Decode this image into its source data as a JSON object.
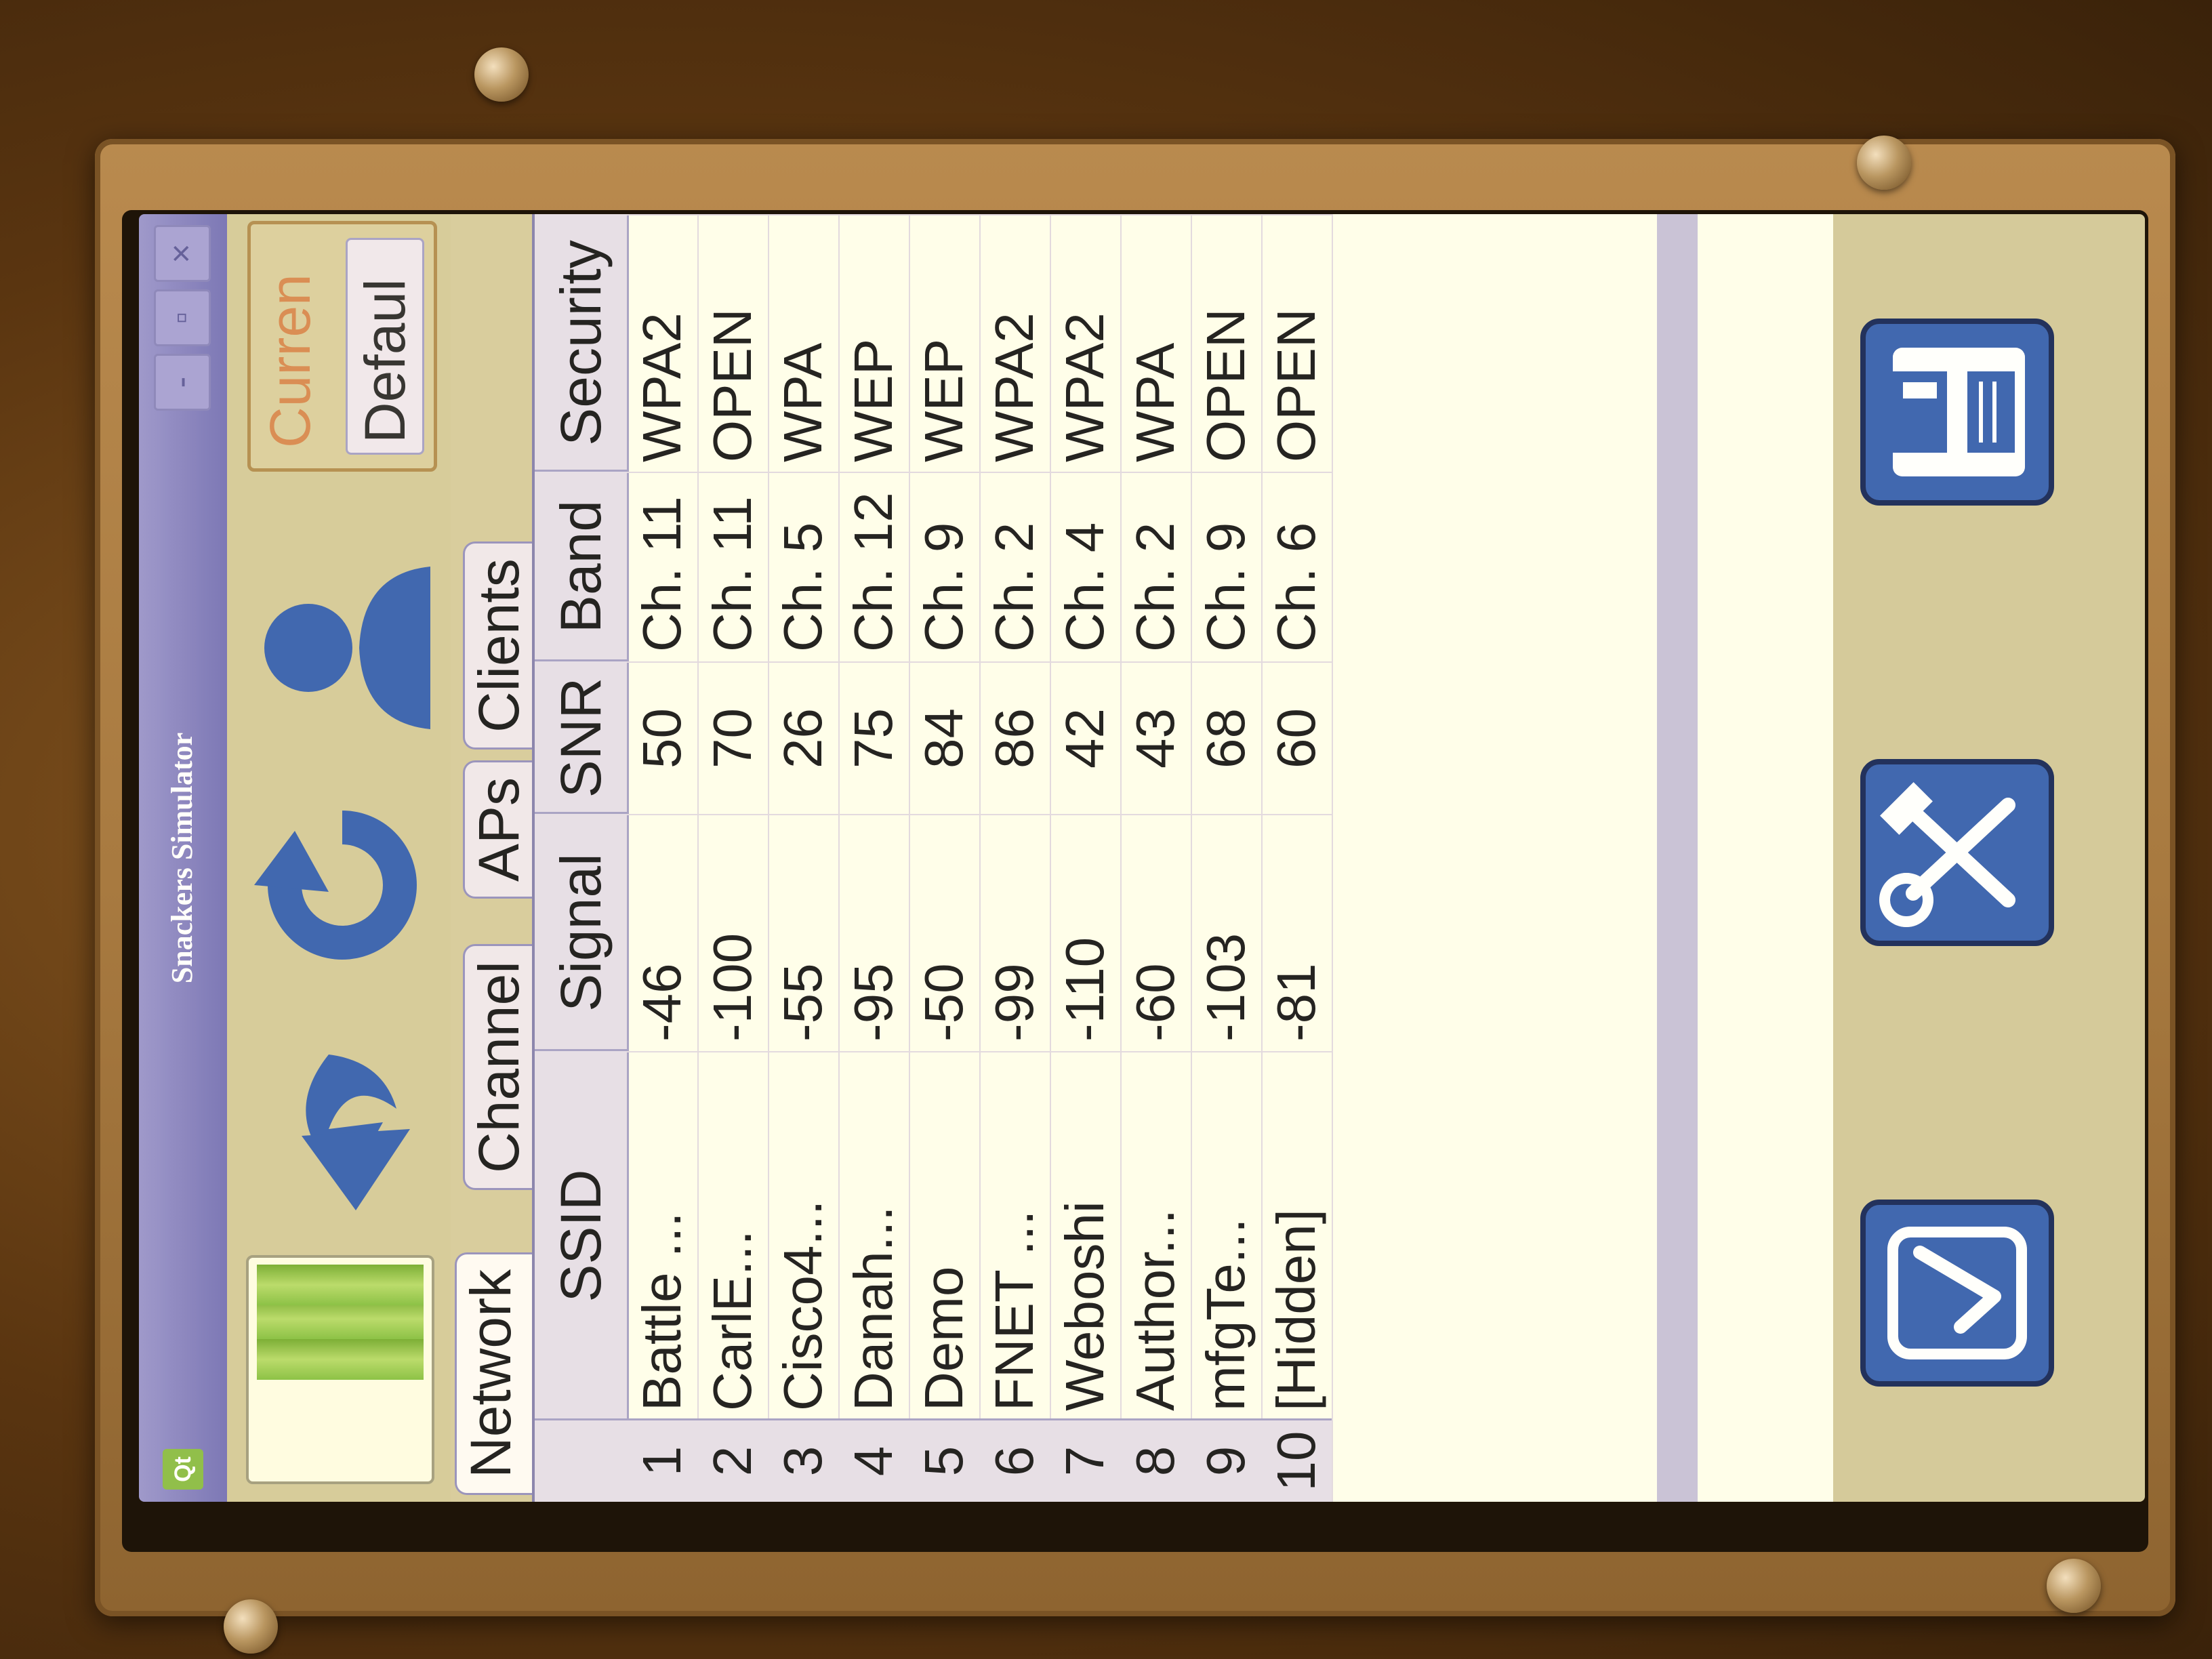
{
  "window": {
    "app_badge": "Qt",
    "title": "Snackers Simulator",
    "minimize_label": "-",
    "restore_label": "▫",
    "close_label": "×"
  },
  "toolbar": {
    "icons": [
      "battery-icon",
      "undo-icon",
      "refresh-icon",
      "user-icon"
    ],
    "current_label": "Curren",
    "default_label": "Defaul"
  },
  "tabs": [
    {
      "label": "Network",
      "active": true
    },
    {
      "label": "Channel",
      "active": false
    },
    {
      "label": "APs",
      "active": false
    },
    {
      "label": "Clients",
      "active": false
    }
  ],
  "table": {
    "columns": [
      "SSID",
      "Signal",
      "SNR",
      "Band",
      "Security"
    ],
    "rows": [
      {
        "num": "1",
        "ssid": "Battle ...",
        "signal": "-46",
        "snr": "50",
        "band": "Ch. 11",
        "security": "WPA2"
      },
      {
        "num": "2",
        "ssid": "CarlE...",
        "signal": "-100",
        "snr": "70",
        "band": "Ch. 11",
        "security": "OPEN"
      },
      {
        "num": "3",
        "ssid": "Cisco4...",
        "signal": "-55",
        "snr": "26",
        "band": "Ch. 5",
        "security": "WPA"
      },
      {
        "num": "4",
        "ssid": "Danah...",
        "signal": "-95",
        "snr": "75",
        "band": "Ch. 12",
        "security": "WEP"
      },
      {
        "num": "5",
        "ssid": "Demo",
        "signal": "-50",
        "snr": "84",
        "band": "Ch. 9",
        "security": "WEP"
      },
      {
        "num": "6",
        "ssid": "FNET ...",
        "signal": "-99",
        "snr": "86",
        "band": "Ch. 2",
        "security": "WPA2"
      },
      {
        "num": "7",
        "ssid": "Weboshi",
        "signal": "-110",
        "snr": "42",
        "band": "Ch. 4",
        "security": "WPA2"
      },
      {
        "num": "8",
        "ssid": "Author...",
        "signal": "-60",
        "snr": "43",
        "band": "Ch. 2",
        "security": "WPA"
      },
      {
        "num": "9",
        "ssid": "mfgTe...",
        "signal": "-103",
        "snr": "68",
        "band": "Ch. 9",
        "security": "OPEN"
      },
      {
        "num": "10",
        "ssid": "[Hidden]",
        "signal": "-81",
        "snr": "60",
        "band": "Ch. 6",
        "security": "OPEN"
      }
    ]
  },
  "actions": {
    "icons": [
      "checkmark-icon",
      "tools-icon",
      "save-icon"
    ]
  },
  "colors": {
    "accent_blue": "#2f63c2",
    "titlebar": "#7878cc",
    "table_header": "#d3d3ee"
  }
}
